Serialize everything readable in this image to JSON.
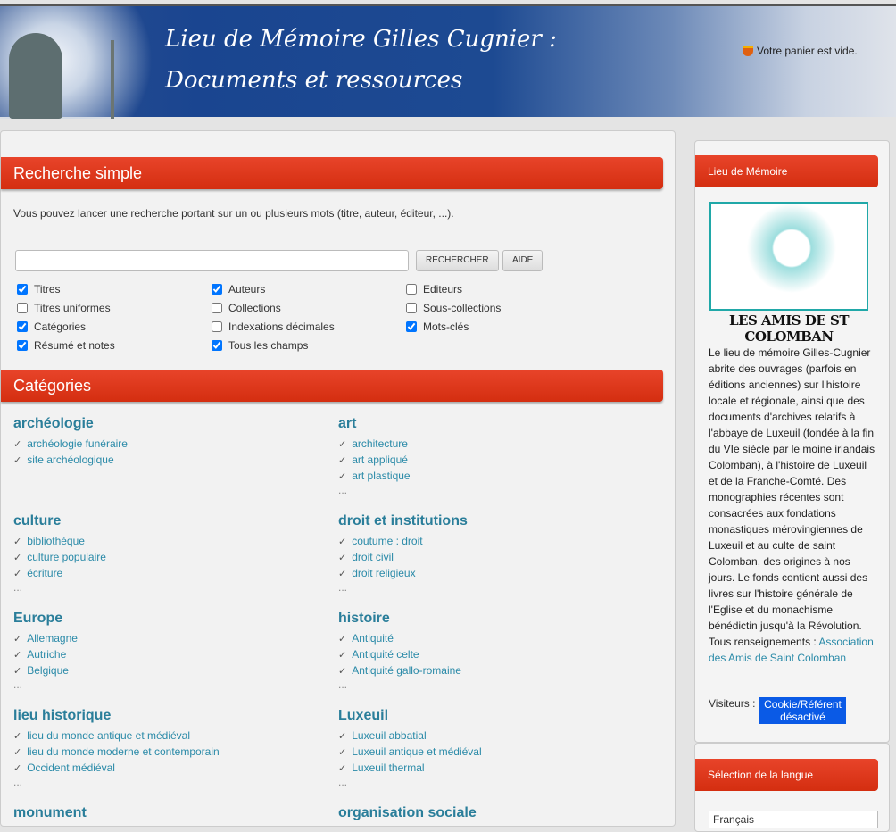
{
  "header": {
    "title_line1": "Lieu de Mémoire Gilles Cugnier :",
    "title_line2": "Documents et ressources",
    "cart": "Votre panier est vide."
  },
  "search": {
    "heading": "Recherche simple",
    "intro": "Vous pouvez lancer une recherche portant sur un ou plusieurs mots (titre, auteur, éditeur, ...).",
    "query": "",
    "search_button": "RECHERCHER",
    "help_button": "AIDE",
    "options": [
      {
        "label": "Titres",
        "checked": true
      },
      {
        "label": "Auteurs",
        "checked": true
      },
      {
        "label": "Editeurs",
        "checked": false
      },
      {
        "label": "Titres uniformes",
        "checked": false
      },
      {
        "label": "Collections",
        "checked": false
      },
      {
        "label": "Sous-collections",
        "checked": false
      },
      {
        "label": "Catégories",
        "checked": true
      },
      {
        "label": "Indexations décimales",
        "checked": false
      },
      {
        "label": "Mots-clés",
        "checked": true
      },
      {
        "label": "Résumé et notes",
        "checked": true
      },
      {
        "label": "Tous les champs",
        "checked": true
      }
    ]
  },
  "categories": {
    "heading": "Catégories",
    "groups": [
      {
        "title": "archéologie",
        "items": [
          "archéologie funéraire",
          "site archéologique"
        ],
        "more": ""
      },
      {
        "title": "art",
        "items": [
          "architecture",
          "art appliqué",
          "art plastique"
        ],
        "more": "..."
      },
      {
        "title": "culture",
        "items": [
          "bibliothèque",
          "culture populaire",
          "écriture"
        ],
        "more": "..."
      },
      {
        "title": "droit et institutions",
        "items": [
          "coutume : droit",
          "droit civil",
          "droit religieux"
        ],
        "more": "..."
      },
      {
        "title": "Europe",
        "items": [
          "Allemagne",
          "Autriche",
          "Belgique"
        ],
        "more": "..."
      },
      {
        "title": "histoire",
        "items": [
          "Antiquité",
          "Antiquité celte",
          "Antiquité gallo-romaine"
        ],
        "more": "..."
      },
      {
        "title": "lieu historique",
        "items": [
          "lieu du monde antique et médiéval",
          "lieu du monde moderne et contemporain",
          "Occident médiéval"
        ],
        "more": "..."
      },
      {
        "title": "Luxeuil",
        "items": [
          "Luxeuil abbatial",
          "Luxeuil antique et médiéval",
          "Luxeuil thermal"
        ],
        "more": "..."
      },
      {
        "title": "monument",
        "items": [],
        "more": ""
      },
      {
        "title": "organisation sociale",
        "items": [],
        "more": ""
      }
    ]
  },
  "sidebar": {
    "heading": "Lieu de Mémoire",
    "logo_text": "LES AMIS DE ST COLOMBAN",
    "text": "Le lieu de mémoire Gilles-Cugnier abrite des ouvrages (parfois en éditions anciennes) sur l'histoire locale et régionale, ainsi que des documents d'archives relatifs à l'abbaye de Luxeuil (fondée à la fin du VIe siècle par le moine irlandais Colomban), à l'histoire de Luxeuil et de la Franche-Comté. Des monographies récentes sont consacrées aux fondations monastiques mérovingiennes de Luxeuil et au culte de saint Colomban, des origines à nos jours. Le fonds contient aussi des livres sur l'histoire générale de l'Eglise et du monachisme bénédictin jusqu'à la Révolution. Tous renseignements :",
    "link": "Association des Amis de Saint Colomban",
    "visitors_label": "Visiteurs :",
    "visitors_badge": "Cookie/Référent désactivé",
    "lang_heading": "Sélection de la langue",
    "lang_value": "Français"
  }
}
